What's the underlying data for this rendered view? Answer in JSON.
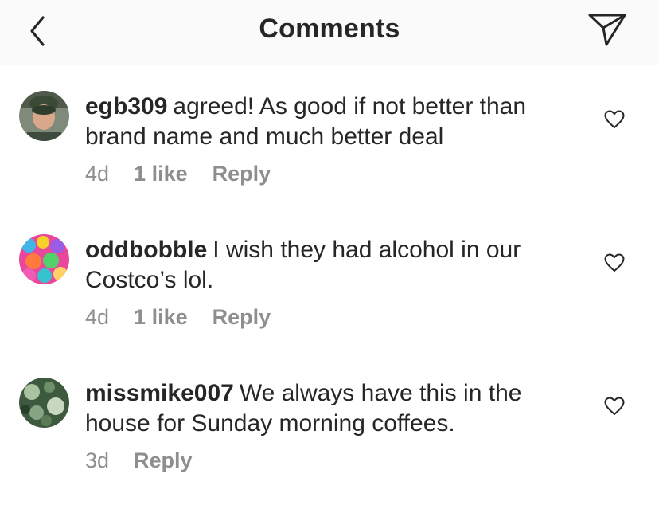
{
  "header": {
    "title": "Comments"
  },
  "comments": [
    {
      "username": "egb309",
      "text": "agreed! As good if not better than brand name and much better deal",
      "time": "4d",
      "likes": "1 like",
      "reply": "Reply"
    },
    {
      "username": "oddbobble",
      "text": "I wish they had alcohol in our Costco’s lol.",
      "time": "4d",
      "likes": "1 like",
      "reply": "Reply"
    },
    {
      "username": "missmike007",
      "text": "We always have this in the house for Sunday morning coffees.",
      "time": "3d",
      "reply": "Reply"
    }
  ],
  "colors": {
    "text": "#262626",
    "secondary": "#8e8e8e",
    "header_bg": "#fafafa",
    "divider": "#c8c8c8"
  },
  "icons": [
    "back-icon",
    "send-icon",
    "heart-icon"
  ]
}
